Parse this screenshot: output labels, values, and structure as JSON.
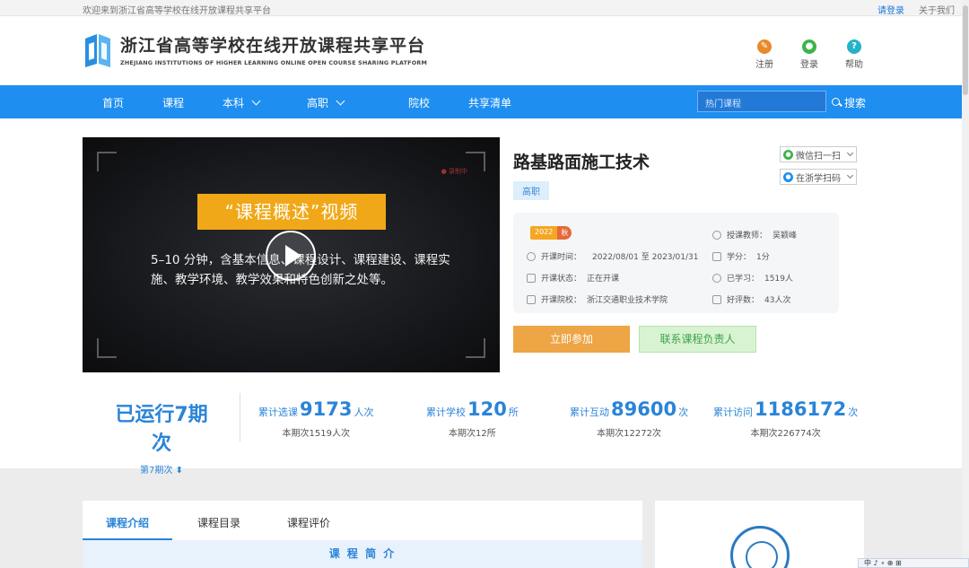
{
  "topbar": {
    "welcome": "欢迎来到浙江省高等学校在线开放课程共享平台",
    "login": "请登录",
    "about": "关于我们"
  },
  "header": {
    "title_cn": "浙江省高等学校在线开放课程共享平台",
    "title_en": "ZHEJIANG INSTITUTIONS OF HIGHER LEARNING ONLINE OPEN COURSE SHARING PLATFORM",
    "register": "注册",
    "login": "登录",
    "help": "帮助"
  },
  "nav": {
    "home": "首页",
    "courses": "课程",
    "undergrad": "本科",
    "vocational": "高职",
    "schools": "院校",
    "sharelist": "共享清单",
    "search_placeholder": "热门课程",
    "search_btn": "搜索"
  },
  "video": {
    "banner": "“课程概述”视频",
    "desc": "5–10 分钟，含基本信息、课程设计、课程建设、课程实施、教学环境、教学效果和特色创新之处等。",
    "watermark": "● 录制中"
  },
  "course": {
    "title": "路基路面施工技术",
    "tag": "高职",
    "share_wechat": "微信扫一扫",
    "share_app": "在浙学扫码",
    "badge_year": "2022",
    "badge_season": "秋",
    "time_label": "开课时间：",
    "time_value": "2022/08/01 至 2023/01/31",
    "status_label": "开课状态：",
    "status_value": "正在开课",
    "school_label": "开课院校：",
    "school_value": "浙江交通职业技术学院",
    "teacher_label": "授课教师：",
    "teacher_value": "吴颖峰",
    "credit_label": "学分：",
    "credit_value": "1分",
    "learned_label": "已学习：",
    "learned_value": "1519人",
    "rating_label": "好评数：",
    "rating_value": "43人次",
    "join_btn": "立即参加",
    "contact_btn": "联系课程负责人"
  },
  "stats": {
    "run_title": "已运行7期次",
    "run_sub": "第7期次 ⬍",
    "enroll_pre": "累计选课",
    "enroll_num": "9173",
    "enroll_unit": "人次",
    "enroll_sub": "本期次1519人次",
    "school_pre": "累计学校",
    "school_num": "120",
    "school_unit": "所",
    "school_sub": "本期次12所",
    "interact_pre": "累计互动",
    "interact_num": "89600",
    "interact_unit": "次",
    "interact_sub": "本期次12272次",
    "visit_pre": "累计访问",
    "visit_num": "1186172",
    "visit_unit": "次",
    "visit_sub": "本期次226774次"
  },
  "tabs": {
    "intro": "课程介绍",
    "catalog": "课程目录",
    "review": "课程评价",
    "section_title": "课 程 简 介"
  },
  "tray": {
    "text": "中 ♪ ∘ ⊕ ⊞"
  }
}
